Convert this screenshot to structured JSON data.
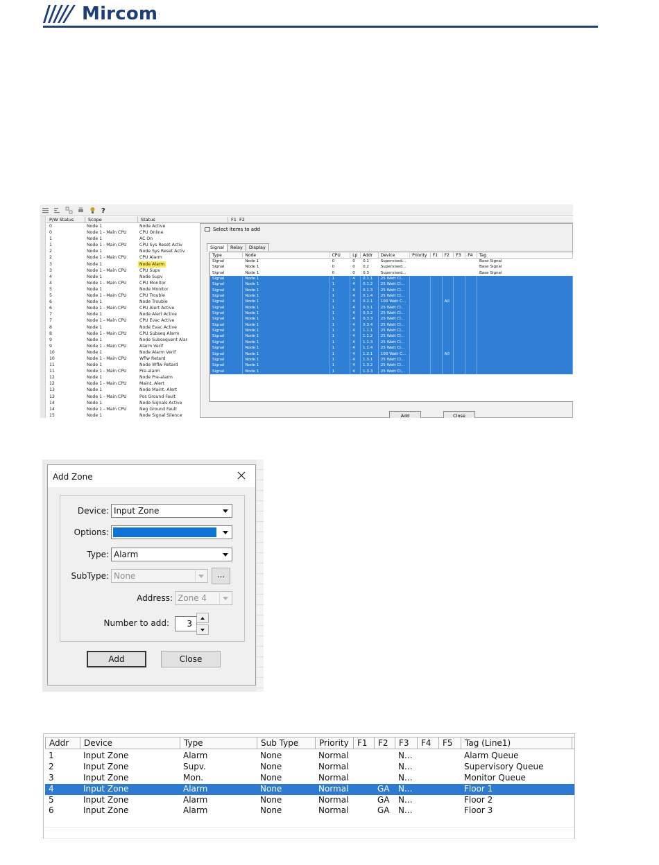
{
  "brand": {
    "name": "Mircom",
    "tm": "·",
    "color": "#1d3f78"
  },
  "shot1": {
    "left_table": {
      "columns": [
        "P/W Status",
        "Scope",
        "Status"
      ],
      "rows": [
        [
          "0",
          "Node 1",
          "Node Active"
        ],
        [
          "0",
          "Node 1 - Main CPU",
          "CPU Online"
        ],
        [
          "1",
          "Node 1",
          "AC On"
        ],
        [
          "1",
          "Node 1 - Main CPU",
          "CPU Sys Reset Activ"
        ],
        [
          "2",
          "Node 1",
          "Node Sys Reset Activ"
        ],
        [
          "2",
          "Node 1 - Main CPU",
          "CPU Alarm"
        ],
        [
          "3",
          "Node 1",
          "Node Alarm"
        ],
        [
          "3",
          "Node 1 - Main CPU",
          "CPU Supv"
        ],
        [
          "4",
          "Node 1",
          "Node Supv"
        ],
        [
          "4",
          "Node 1 - Main CPU",
          "CPU Monitor"
        ],
        [
          "5",
          "Node 1",
          "Node Monitor"
        ],
        [
          "5",
          "Node 1 - Main CPU",
          "CPU Trouble"
        ],
        [
          "6",
          "Node 1",
          "Node Trouble"
        ],
        [
          "6",
          "Node 1 - Main CPU",
          "CPU Alert Active"
        ],
        [
          "7",
          "Node 1",
          "Node Alert Active"
        ],
        [
          "7",
          "Node 1 - Main CPU",
          "CPU Evac Active"
        ],
        [
          "8",
          "Node 1",
          "Node Evac Active"
        ],
        [
          "8",
          "Node 1 - Main CPU",
          "CPU Subseq Alarm"
        ],
        [
          "9",
          "Node 1",
          "Node Subsequent Alar"
        ],
        [
          "9",
          "Node 1 - Main CPU",
          "Alarm Verif"
        ],
        [
          "10",
          "Node 1",
          "Node Alarm Verif"
        ],
        [
          "10",
          "Node 1 - Main CPU",
          "Wflw Retard"
        ],
        [
          "11",
          "Node 1",
          "Node Wflw Retard"
        ],
        [
          "11",
          "Node 1 - Main CPU",
          "Pre-alarm"
        ],
        [
          "12",
          "Node 1",
          "Node Pre-alarm"
        ],
        [
          "12",
          "Node 1 - Main CPU",
          "Maint. Alert"
        ],
        [
          "13",
          "Node 1",
          "Node Maint. Alert"
        ],
        [
          "13",
          "Node 1 - Main CPU",
          "Pos Ground Fault"
        ],
        [
          "14",
          "Node 1",
          "Node Signals Active"
        ],
        [
          "14",
          "Node 1 - Main CPU",
          "Neg Ground Fault"
        ],
        [
          "15",
          "Node 1",
          "Node Signal Silence"
        ]
      ],
      "highlight_row": 6,
      "highlight_color": "#ffe94d"
    },
    "right_head": [
      "F1",
      "F2"
    ],
    "select_dialog": {
      "title": "Select items to add",
      "tabs": [
        "Signal",
        "Relay",
        "Display"
      ],
      "columns": [
        "Type",
        "Node",
        "CPU",
        "Lp",
        "Addr",
        "Device",
        "Priority",
        "F1",
        "F2",
        "F3",
        "F4",
        "Tag"
      ],
      "rows": [
        [
          "Signal",
          "Node 1",
          "0",
          "0",
          "0.1",
          "Supervised...",
          "",
          "",
          "",
          "",
          "",
          "Base Signal"
        ],
        [
          "Signal",
          "Node 1",
          "0",
          "0",
          "0.2",
          "Supervised...",
          "",
          "",
          "",
          "",
          "",
          "Base Signal"
        ],
        [
          "Signal",
          "Node 1",
          "0",
          "0",
          "0.3",
          "Supervised...",
          "",
          "",
          "",
          "",
          "",
          "Base Signal"
        ],
        [
          "Signal",
          "Node 1",
          "1",
          "4",
          "0.1.1",
          "25 Watt Cl...",
          "",
          "",
          "",
          "",
          "",
          ""
        ],
        [
          "Signal",
          "Node 1",
          "1",
          "4",
          "0.1.2",
          "25 Watt Cl...",
          "",
          "",
          "",
          "",
          "",
          ""
        ],
        [
          "Signal",
          "Node 1",
          "1",
          "4",
          "0.1.3",
          "25 Watt Cl...",
          "",
          "",
          "",
          "",
          "",
          ""
        ],
        [
          "Signal",
          "Node 1",
          "1",
          "4",
          "0.1.4",
          "25 Watt Cl...",
          "",
          "",
          "",
          "",
          "",
          ""
        ],
        [
          "Signal",
          "Node 1",
          "1",
          "4",
          "0.2.1",
          "100 Watt C...",
          "",
          "",
          "A/I",
          "",
          "",
          ""
        ],
        [
          "Signal",
          "Node 1",
          "1",
          "4",
          "0.3.1",
          "25 Watt Cl...",
          "",
          "",
          "",
          "",
          "",
          ""
        ],
        [
          "Signal",
          "Node 1",
          "1",
          "4",
          "0.3.2",
          "25 Watt Cl...",
          "",
          "",
          "",
          "",
          "",
          ""
        ],
        [
          "Signal",
          "Node 1",
          "1",
          "4",
          "0.3.3",
          "25 Watt Cl...",
          "",
          "",
          "",
          "",
          "",
          ""
        ],
        [
          "Signal",
          "Node 1",
          "1",
          "4",
          "0.3.4",
          "25 Watt Cl...",
          "",
          "",
          "",
          "",
          "",
          ""
        ],
        [
          "Signal",
          "Node 1",
          "1",
          "4",
          "1.1.1",
          "25 Watt Cl...",
          "",
          "",
          "",
          "",
          "",
          ""
        ],
        [
          "Signal",
          "Node 1",
          "1",
          "4",
          "1.1.2",
          "25 Watt Cl...",
          "",
          "",
          "",
          "",
          "",
          ""
        ],
        [
          "Signal",
          "Node 1",
          "1",
          "4",
          "1.1.3",
          "25 Watt Cl...",
          "",
          "",
          "",
          "",
          "",
          ""
        ],
        [
          "Signal",
          "Node 1",
          "1",
          "4",
          "1.1.4",
          "25 Watt Cl...",
          "",
          "",
          "",
          "",
          "",
          ""
        ],
        [
          "Signal",
          "Node 1",
          "1",
          "4",
          "1.2.1",
          "100 Watt C...",
          "",
          "",
          "A/I",
          "",
          "",
          ""
        ],
        [
          "Signal",
          "Node 1",
          "1",
          "4",
          "1.3.1",
          "25 Watt Cl...",
          "",
          "",
          "",
          "",
          "",
          ""
        ],
        [
          "Signal",
          "Node 1",
          "1",
          "4",
          "1.3.2",
          "25 Watt Cl...",
          "",
          "",
          "",
          "",
          "",
          ""
        ],
        [
          "Signal",
          "Node 1",
          "1",
          "4",
          "1.3.3",
          "25 Watt Cl...",
          "",
          "",
          "",
          "",
          "",
          ""
        ]
      ],
      "selected_from": 3,
      "add_label": "Add",
      "close_label": "Close"
    }
  },
  "add_zone": {
    "title": "Add Zone",
    "device_label": "Device:",
    "device_value": "Input Zone",
    "options_label": "Options:",
    "options_value": "",
    "type_label": "Type:",
    "type_value": "Alarm",
    "subtype_label": "SubType:",
    "subtype_value": "None",
    "dots_label": "...",
    "address_label": "Address:",
    "address_value": "Zone 4",
    "number_label": "Number to add:",
    "number_value": "3",
    "add_label": "Add",
    "close_label": "Close"
  },
  "zone_table": {
    "columns": [
      "Addr",
      "Device",
      "Type",
      "Sub Type",
      "Priority",
      "F1",
      "F2",
      "F3",
      "F4",
      "F5",
      "Tag (Line1)"
    ],
    "rows": [
      [
        "1",
        "Input Zone",
        "Alarm",
        "None",
        "Normal",
        "",
        "",
        "N...",
        "",
        "",
        "Alarm Queue"
      ],
      [
        "2",
        "Input Zone",
        "Supv.",
        "None",
        "Normal",
        "",
        "",
        "N...",
        "",
        "",
        "Supervisory Queue"
      ],
      [
        "3",
        "Input Zone",
        "Mon.",
        "None",
        "Normal",
        "",
        "",
        "N...",
        "",
        "",
        "Monitor Queue"
      ],
      [
        "4",
        "Input Zone",
        "Alarm",
        "None",
        "Normal",
        "",
        "GA",
        "N...",
        "",
        "",
        "Floor 1"
      ],
      [
        "5",
        "Input Zone",
        "Alarm",
        "None",
        "Normal",
        "",
        "GA",
        "N...",
        "",
        "",
        "Floor 2"
      ],
      [
        "6",
        "Input Zone",
        "Alarm",
        "None",
        "Normal",
        "",
        "GA",
        "N...",
        "",
        "",
        "Floor 3"
      ]
    ],
    "selected_row": 3,
    "selection_color": "#2d7ad1"
  }
}
